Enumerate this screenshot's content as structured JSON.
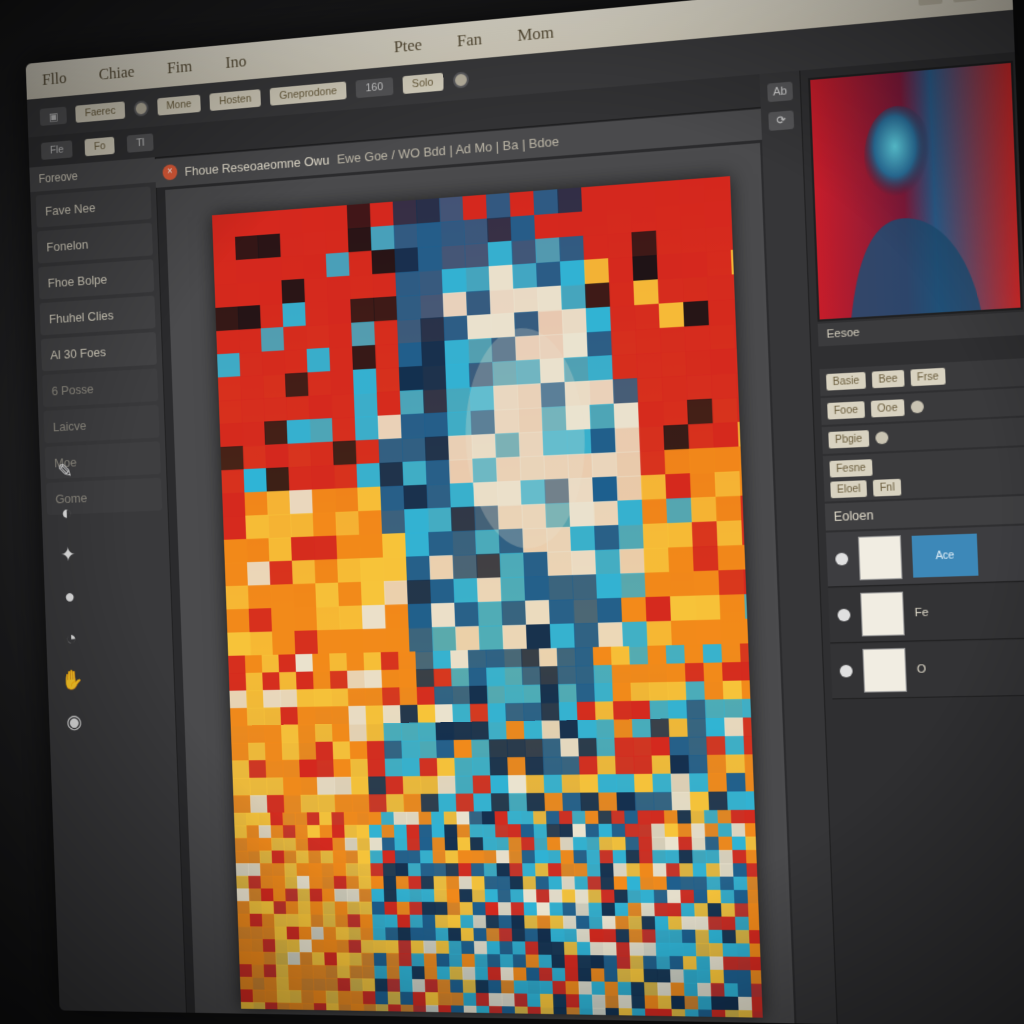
{
  "menubar": {
    "items": [
      "Fllo",
      "Chiae",
      "Fim",
      "Ino",
      "Ptee",
      "Fan",
      "Mom"
    ]
  },
  "options": {
    "chips": [
      "Faerec",
      "Mone",
      "Hosten",
      "Gneprodone",
      "Solo"
    ],
    "zoom": "160"
  },
  "options2": {
    "chips": [
      "Fle",
      "Fo",
      "Tl"
    ]
  },
  "left_panel": {
    "header": "Foreove",
    "items": [
      "Fave Nee",
      "Fonelon",
      "Fhoe Bolpe",
      "Fhuhel Clies",
      "Al 30 Foes"
    ],
    "dim_items": [
      "6 Posse",
      "Laicve",
      "Moe",
      "Gome"
    ]
  },
  "document": {
    "tab_title": "Fhoue Reseoaeomne Owu",
    "tab_meta": "Ewe  Goe / WO  Bdd  |  Ad Mo  |  Ba  |  Bdoe",
    "close_symbol": "×"
  },
  "canvas": {
    "colors": {
      "red": "#d4281e",
      "orange": "#f28a1a",
      "yellow": "#f7c43a",
      "cyan": "#2fb4d6",
      "blue": "#1d5f8e",
      "navy": "#13304f",
      "cream": "#eae3cf",
      "dark": "#1b1216"
    }
  },
  "right_panel": {
    "strip_icons": [
      "Ab",
      "⟳"
    ],
    "preview_label": "Eesoe",
    "prop_rows": [
      [
        "Basie",
        "Bee",
        "Frse"
      ],
      [
        "Fooe",
        "Ooe"
      ],
      [
        "Pbgie"
      ],
      [
        "Fesne"
      ],
      [
        "Eloel",
        "Fnl"
      ]
    ],
    "layers_header": "Eoloen",
    "layers": [
      {
        "name": "Ace",
        "active": true
      },
      {
        "name": "Fe",
        "active": false
      },
      {
        "name": "O",
        "active": false
      }
    ]
  }
}
